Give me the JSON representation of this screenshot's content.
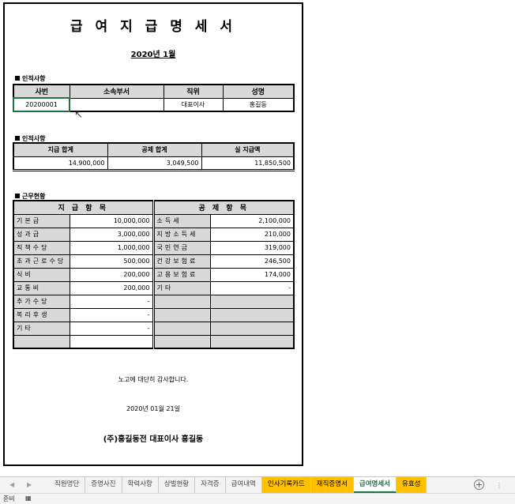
{
  "doc": {
    "title": "급 여 지 급 명 세 서",
    "period": "2020년 1월",
    "section1": "인적사항",
    "section2": "인적사항",
    "section3": "근무현황",
    "thanks": "노고에 대단히 감사합니다.",
    "date": "2020년 01월 21일",
    "company": "(주)홍길동전 대표이사 홍길동"
  },
  "personal": {
    "headers": [
      "사번",
      "소속부서",
      "직위",
      "성명"
    ],
    "values": [
      "20200001",
      "",
      "대표이사",
      "홍길동"
    ]
  },
  "summary": {
    "headers": [
      "지급 합계",
      "공제 합계",
      "실 지급액"
    ],
    "values": [
      "14,900,000",
      "3,049,500",
      "11,850,500"
    ]
  },
  "work": {
    "pay_header": "지 급 항 목",
    "ded_header": "공 제 항 목",
    "rows": [
      {
        "pay_label": "기본급",
        "pay_value": "10,000,000",
        "ded_label": "소득세",
        "ded_value": "2,100,000"
      },
      {
        "pay_label": "성과급",
        "pay_value": "3,000,000",
        "ded_label": "지방소득세",
        "ded_value": "210,000"
      },
      {
        "pay_label": "직책수당",
        "pay_value": "1,000,000",
        "ded_label": "국민연금",
        "ded_value": "319,000"
      },
      {
        "pay_label": "초과근로수당",
        "pay_value": "500,000",
        "ded_label": "건강보험료",
        "ded_value": "246,500"
      },
      {
        "pay_label": "식비",
        "pay_value": "200,000",
        "ded_label": "고용보험료",
        "ded_value": "174,000"
      },
      {
        "pay_label": "교통비",
        "pay_value": "200,000",
        "ded_label": "기타",
        "ded_value": "-"
      },
      {
        "pay_label": "추가수당",
        "pay_value": "-",
        "ded_label": "",
        "ded_value": ""
      },
      {
        "pay_label": "복리후생",
        "pay_value": "-",
        "ded_label": "",
        "ded_value": ""
      },
      {
        "pay_label": "기타",
        "pay_value": "-",
        "ded_label": "",
        "ded_value": ""
      },
      {
        "pay_label": "",
        "pay_value": "",
        "ded_label": "",
        "ded_value": ""
      }
    ]
  },
  "tabs": [
    {
      "label": "직원명단",
      "style": "normal"
    },
    {
      "label": "증명사진",
      "style": "normal"
    },
    {
      "label": "학력사항",
      "style": "normal"
    },
    {
      "label": "상벌현황",
      "style": "normal"
    },
    {
      "label": "자격증",
      "style": "normal"
    },
    {
      "label": "급여내역",
      "style": "normal"
    },
    {
      "label": "인사기록카드",
      "style": "yellow"
    },
    {
      "label": "재직증명서",
      "style": "yellow"
    },
    {
      "label": "급여명세서",
      "style": "active"
    },
    {
      "label": "유효성",
      "style": "yellow"
    }
  ],
  "status": {
    "ready": "준비"
  },
  "colors": {
    "header_gray": "#d9d9d9",
    "excel_green": "#217346",
    "tab_yellow": "#ffc000"
  }
}
